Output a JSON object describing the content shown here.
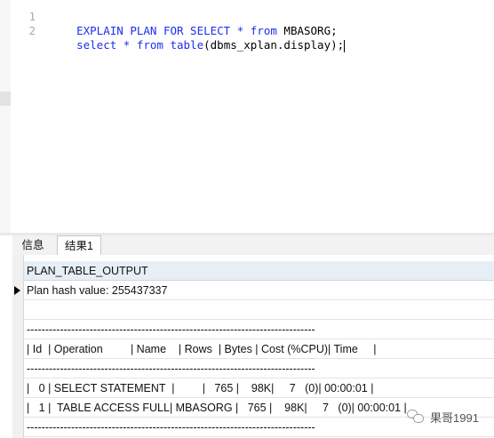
{
  "editor": {
    "line_numbers": [
      "1",
      "2"
    ],
    "lines": [
      [
        {
          "t": "EXPLAIN PLAN FOR SELECT * ",
          "c": "kw"
        },
        {
          "t": "from",
          "c": "kw"
        },
        {
          "t": " MBASORG;",
          "c": "ident"
        }
      ],
      [
        {
          "t": "select * ",
          "c": "kw"
        },
        {
          "t": "from",
          "c": "kw"
        },
        {
          "t": " ",
          "c": "ident"
        },
        {
          "t": "table",
          "c": "kw"
        },
        {
          "t": "(dbms_xplan.display);",
          "c": "ident"
        }
      ]
    ],
    "colors": {
      "keyword": "#1c2ef0",
      "identifier": "#000000"
    }
  },
  "tabs": {
    "info_label": "信息",
    "result_label": "结果1"
  },
  "results": {
    "column_header": "PLAN_TABLE_OUTPUT",
    "rows": [
      "Plan hash value: 255437337",
      "",
      "------------------------------------------------------------------------------",
      "| Id  | Operation         | Name    | Rows  | Bytes | Cost (%CPU)| Time     |",
      "------------------------------------------------------------------------------",
      "|   0 | SELECT STATEMENT  |         |   765 |    98K|     7   (0)| 00:00:01 |",
      "|   1 |  TABLE ACCESS FULL| MBASORG |   765 |    98K|     7   (0)| 00:00:01 |",
      "------------------------------------------------------------------------------"
    ]
  },
  "watermark": {
    "text": "果哥1991"
  }
}
